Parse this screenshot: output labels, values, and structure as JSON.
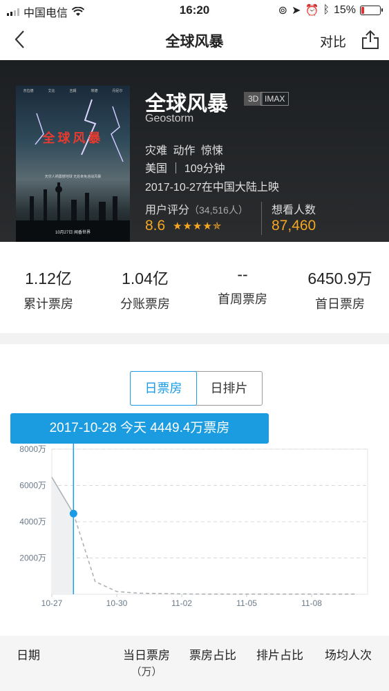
{
  "status_bar": {
    "carrier": "中国电信",
    "time": "16:20",
    "battery": "15%",
    "battery_level": 0.15
  },
  "nav": {
    "title": "全球风暴",
    "compare_label": "对比"
  },
  "movie": {
    "title": "全球风暴",
    "badges": [
      "3D",
      "IMAX"
    ],
    "english_title": "Geostorm",
    "genres": "灾难 动作 惊悚",
    "country_duration": "美国 ｜ 109分钟",
    "release": "2017-10-27在中国大陆上映",
    "rating_label": "用户评分",
    "rating_count": "（34,516人）",
    "rating": "8.6",
    "stars": "★★★★✯",
    "want_label": "想看人数",
    "want_count": "87,460",
    "poster": {
      "title": "全球风暴",
      "cast": [
        "杰拉德",
        "艾比",
        "吉姆",
        "埃德",
        "丹尼尔"
      ],
      "tagline": "天灾人祸震撼地球 无处幸免迎战风暴",
      "date": "10月27日 闻香世界"
    }
  },
  "stats": [
    {
      "value": "1.12亿",
      "label": "累计票房"
    },
    {
      "value": "1.04亿",
      "label": "分账票房"
    },
    {
      "value": "--",
      "label": "首周票房"
    },
    {
      "value": "6450.9万",
      "label": "首日票房"
    }
  ],
  "tabs": [
    {
      "label": "日票房",
      "active": true
    },
    {
      "label": "日排片",
      "active": false
    }
  ],
  "tooltip": "2017-10-28 今天 4449.4万票房",
  "chart_data": {
    "type": "line",
    "x": [
      "10-27",
      "10-28",
      "10-29",
      "10-30",
      "10-31",
      "11-01",
      "11-02",
      "11-03",
      "11-04",
      "11-05",
      "11-06",
      "11-07",
      "11-08",
      "11-09",
      "11-10"
    ],
    "x_ticks": [
      "10-27",
      "10-30",
      "11-02",
      "11-05",
      "11-08"
    ],
    "y_ticks": [
      "8000万",
      "6000万",
      "4000万",
      "2000万"
    ],
    "ylim": [
      0,
      8000
    ],
    "series": [
      {
        "values": [
          6450.9,
          4449.4,
          700,
          150,
          60,
          40,
          20,
          10,
          10,
          10,
          10,
          10,
          10,
          10,
          10
        ],
        "actual_count": 2
      }
    ],
    "selected_index": 1,
    "grid": true
  },
  "table_header": [
    {
      "label": "日期"
    },
    {
      "label": "当日票房",
      "sub": "（万）"
    },
    {
      "label": "票房占比"
    },
    {
      "label": "排片占比"
    },
    {
      "label": "场均人次"
    }
  ],
  "colors": {
    "accent": "#1a9be6",
    "rating": "#f5a623",
    "hero_bg": "#1c1f22"
  }
}
